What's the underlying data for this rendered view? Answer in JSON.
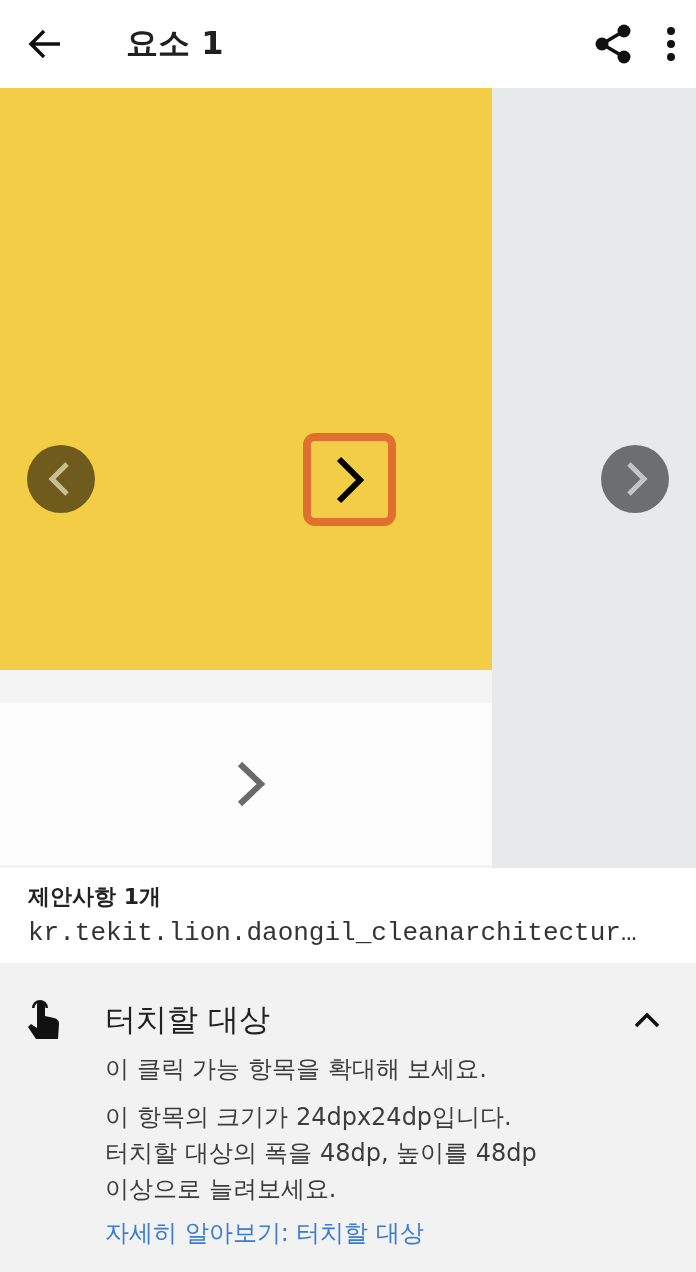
{
  "app_bar": {
    "title": "요소 1"
  },
  "suggestions": {
    "count_label": "제안사항 1개",
    "package": "kr.tekit.lion.daongil_cleanarchitectur…"
  },
  "issue": {
    "title": "터치할 대상",
    "expanded": true,
    "summary": "이 클릭 가능 항목을 확대해 보세요.",
    "details": [
      "이 항목의 크기가 24dpx24dp입니다.",
      "터치할 대상의 폭을 48dp, 높이를 48dp 이상으로 늘려보세요."
    ],
    "link": "자세히 알아보기: 터치할 대상"
  }
}
